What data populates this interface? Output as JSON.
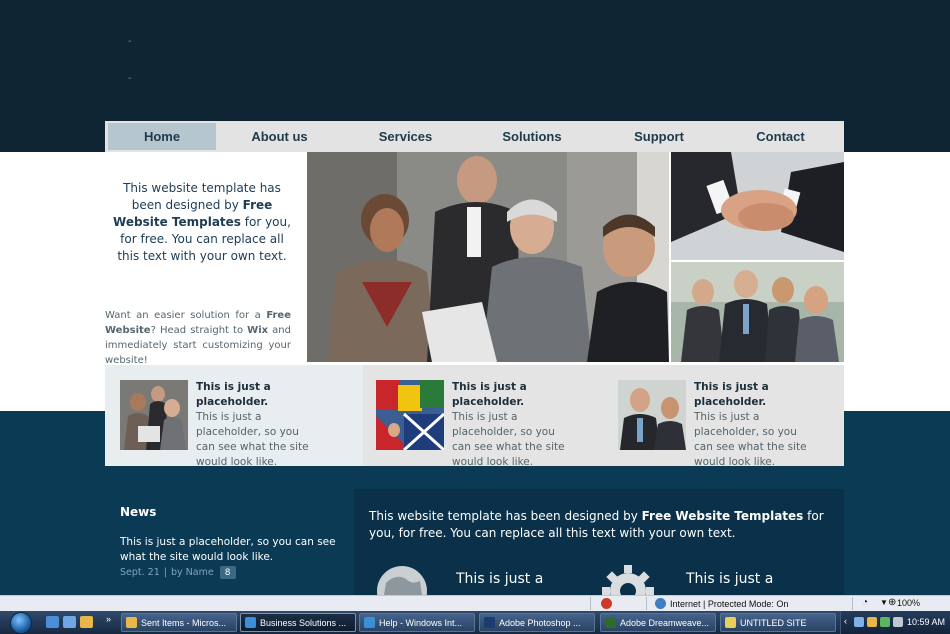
{
  "nav": {
    "items": [
      "Home",
      "About us",
      "Services",
      "Solutions",
      "Support",
      "Contact"
    ]
  },
  "header": {
    "dash1": "-",
    "dash2": "-"
  },
  "intro": {
    "p1_pre": "This website template has been designed by ",
    "p1_bold": "Free Website Templates",
    "p1_post": " for you, for free. You can replace all this text with your own text.",
    "p2_a": "Want an easier solution for a ",
    "p2_b": "Free Website",
    "p2_c": "? Head straight to ",
    "p2_d": "Wix",
    "p2_e": " and immediately start customizing your website!"
  },
  "placeholders": [
    {
      "title": "This is just a placeholder.",
      "body": "This is just a placeholder, so you can see what the site would look like."
    },
    {
      "title": "This is just a placeholder.",
      "body": "This is just a placeholder, so you can see what the site would look like."
    },
    {
      "title": "This is just a placeholder.",
      "body": "This is just a placeholder, so you can see what the site would look like."
    }
  ],
  "news": {
    "title": "News",
    "text": "This is just a placeholder, so you can see what the site would look like.",
    "date": "Sept. 21",
    "sep": "|",
    "by": "by Name",
    "count": "8"
  },
  "panel": {
    "pre": "This website template has been designed by ",
    "bold": "Free Website Templates",
    "post": " for you, for free. You can replace all this text with your own text.",
    "sub1": "This is just a",
    "sub2": "This is just a"
  },
  "statusbar": {
    "zone": "Internet | Protected Mode: On",
    "zoom": "100%"
  },
  "taskbar": {
    "tasks": [
      "Sent Items - Micros...",
      "Business Solutions ...",
      "Help - Windows Int...",
      "Adobe Photoshop ...",
      "Adobe Dreamweave...",
      "UNTITLED SITE"
    ],
    "clock": "10:59 AM"
  },
  "colors": {
    "header_bg": "#0f2533",
    "lower_bg": "#0b3a55",
    "nav_bg": "#e3e3e3",
    "nav_active": "#b6c6cf",
    "heading_text": "#1d3c55"
  }
}
